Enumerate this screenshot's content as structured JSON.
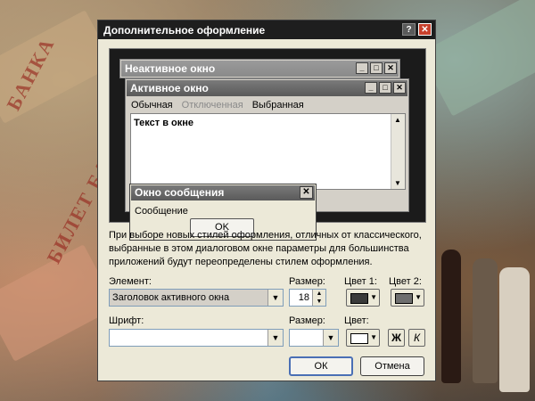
{
  "dialog": {
    "title": "Дополнительное оформление",
    "help_icon": "help-icon",
    "close_icon": "close-icon"
  },
  "preview": {
    "inactive_title": "Неактивное окно",
    "active_title": "Активное окно",
    "menu": [
      "Обычная",
      "Отключенная",
      "Выбранная"
    ],
    "window_text": "Текст в окне",
    "message_title": "Окно сообщения",
    "message_text": "Сообщение",
    "ok_label": "OK"
  },
  "description": "При выборе новых стилей оформления, отличных от классического, выбранные в этом диалоговом окне параметры для большинства приложений будут переопределены стилем оформления.",
  "element": {
    "label": "Элемент:",
    "value": "Заголовок активного окна",
    "size_label": "Размер:",
    "size_value": "18",
    "color1_label": "Цвет 1:",
    "color2_label": "Цвет 2:",
    "color1": "#3a3a3a",
    "color2": "#6e6e6e"
  },
  "font": {
    "label": "Шрифт:",
    "value": "",
    "size_label": "Размер:",
    "size_value": "",
    "color_label": "Цвет:",
    "color": "#ffffff",
    "bold_label": "Ж",
    "italic_label": "К"
  },
  "buttons": {
    "ok": "ОК",
    "cancel": "Отмена"
  }
}
